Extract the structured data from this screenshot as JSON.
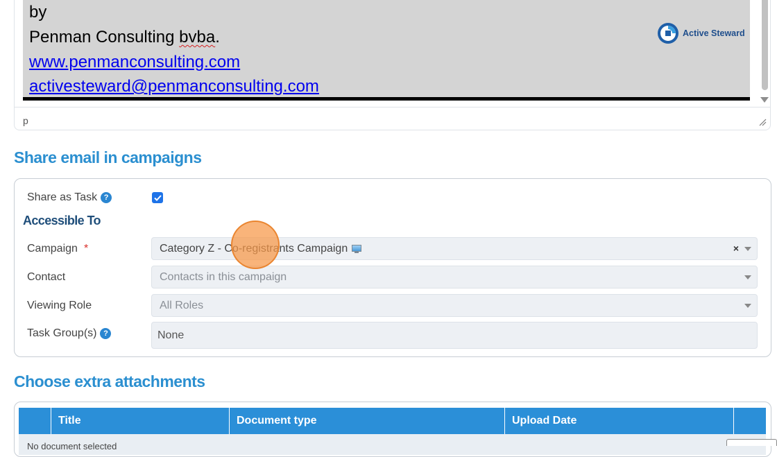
{
  "editor": {
    "lines": {
      "by": "by",
      "company_prefix": "Penman Consulting ",
      "company_misspelled": "bvba",
      "company_suffix": ".",
      "website": "www.penmanconsulting.com",
      "email": "activesteward@penmanconsulting.com"
    },
    "logo_text": "Active Steward",
    "status_path": "p"
  },
  "share_section": {
    "title": "Share email in campaigns",
    "share_as_task": {
      "label": "Share as Task",
      "checked": true
    },
    "accessible_to_heading": "Accessible To",
    "campaign": {
      "label": "Campaign",
      "required_mark": "*",
      "value": "Category Z - Co-registrants Campaign",
      "clear": "×"
    },
    "contact": {
      "label": "Contact",
      "placeholder": "Contacts in this campaign"
    },
    "viewing_role": {
      "label": "Viewing Role",
      "placeholder": "All Roles"
    },
    "task_groups": {
      "label": "Task Group(s)",
      "value": "None"
    },
    "help_glyph": "?"
  },
  "attachments_section": {
    "title": "Choose extra attachments",
    "columns": [
      "",
      "Title",
      "Document type",
      "Upload Date",
      ""
    ],
    "empty_text": "No document selected"
  },
  "colors": {
    "accent": "#2b8fd0",
    "header_bg": "#2b8fd8",
    "checkbox": "#1e73e8",
    "click_indicator": "#f79746"
  }
}
